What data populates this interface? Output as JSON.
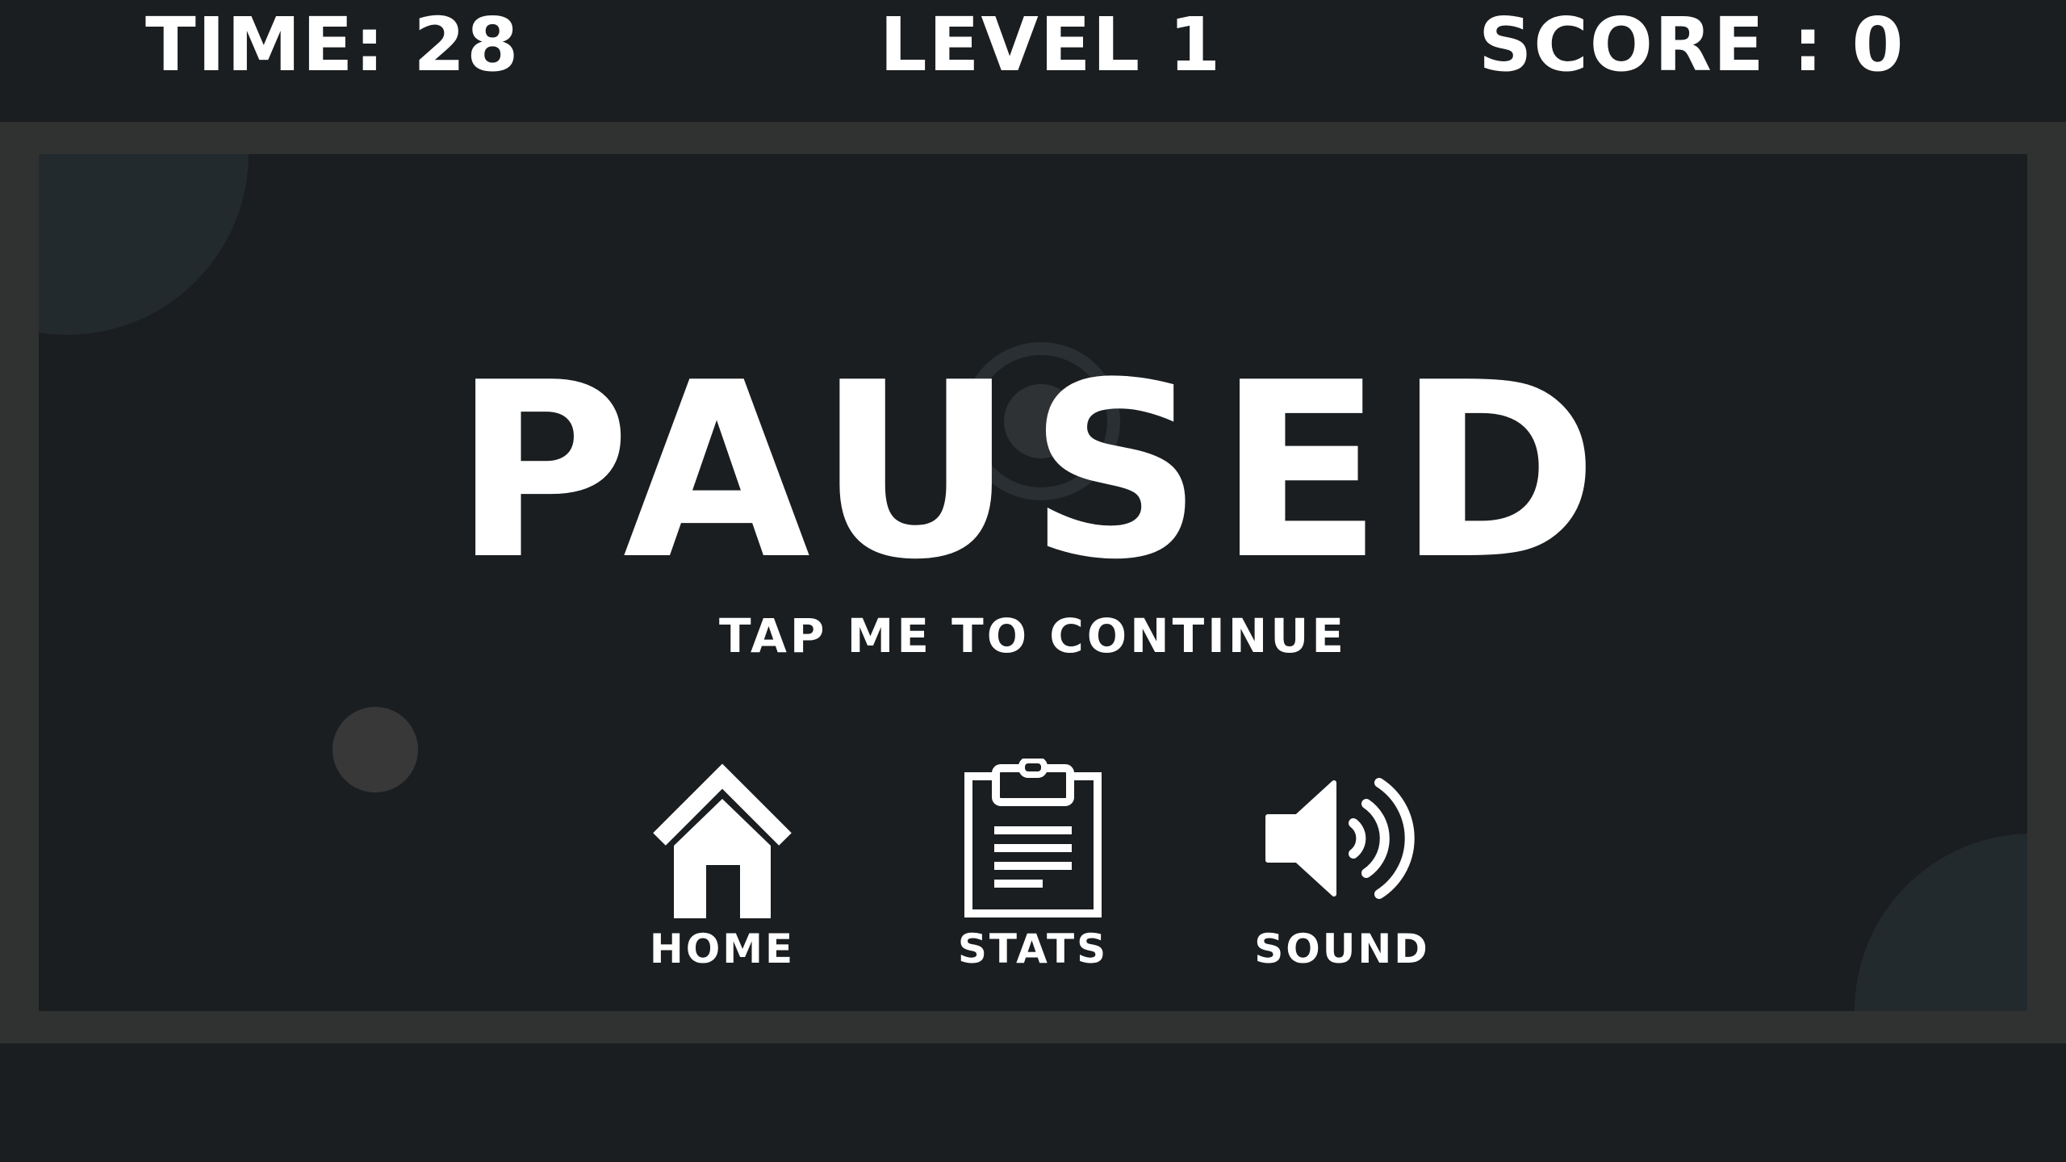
{
  "hud": {
    "time": "TIME: 28",
    "level": "LEVEL 1",
    "score": "SCORE : 0"
  },
  "overlay": {
    "title": "PAUSED",
    "continue": "TAP ME TO CONTINUE"
  },
  "menu": [
    {
      "label": "HOME",
      "icon": "home-icon"
    },
    {
      "label": "STATS",
      "icon": "clipboard-icon"
    },
    {
      "label": "SOUND",
      "icon": "speaker-icon"
    }
  ],
  "colors": {
    "background": "#1b1e20",
    "frame": "#303131",
    "text": "#ffffff"
  }
}
